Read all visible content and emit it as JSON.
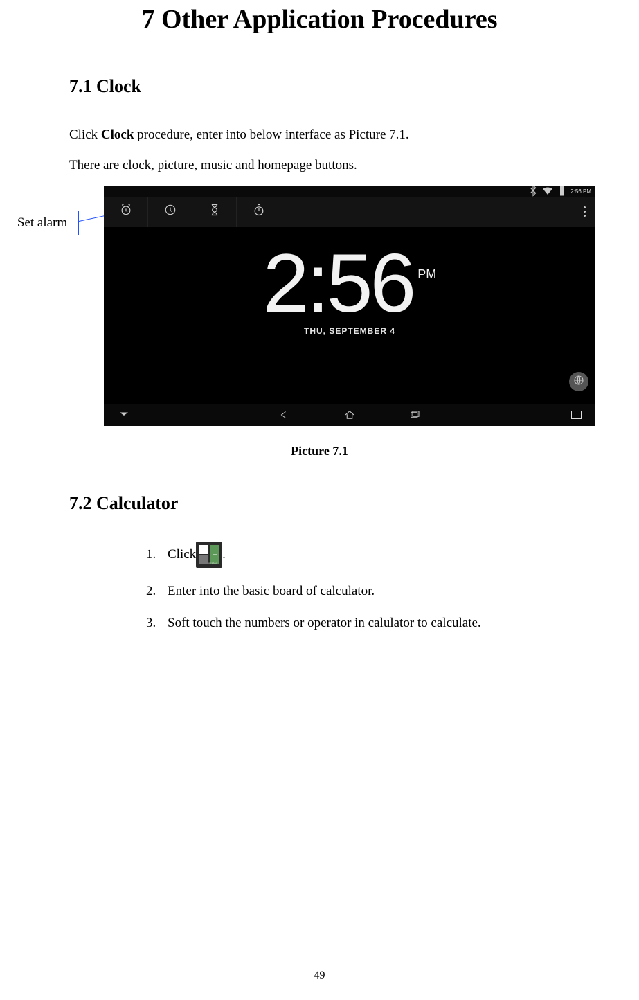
{
  "heading": "7 Other Application Procedures",
  "section71": {
    "title": "7.1 Clock",
    "para1_pre": "Click ",
    "para1_bold": "Clock",
    "para1_post": " procedure, enter into below interface as Picture 7.1.",
    "para2": "There are clock, picture, music and homepage buttons."
  },
  "callout": {
    "label": "Set alarm"
  },
  "device": {
    "status_time": "2:56 PM",
    "clock_time": "2:56",
    "clock_ampm": "PM",
    "date": "THU, SEPTEMBER 4",
    "tabs": [
      "alarm",
      "clock",
      "timer",
      "stopwatch"
    ]
  },
  "caption71": "Picture 7.1",
  "section72": {
    "title": "7.2 Calculator",
    "items": [
      {
        "pre": "Click",
        "post": "."
      },
      {
        "text": "Enter into the basic board of calculator."
      },
      {
        "text": "Soft touch the numbers or operator in calulator to calculate."
      }
    ],
    "calc_icon_label": "Calculator"
  },
  "page_number": "49"
}
